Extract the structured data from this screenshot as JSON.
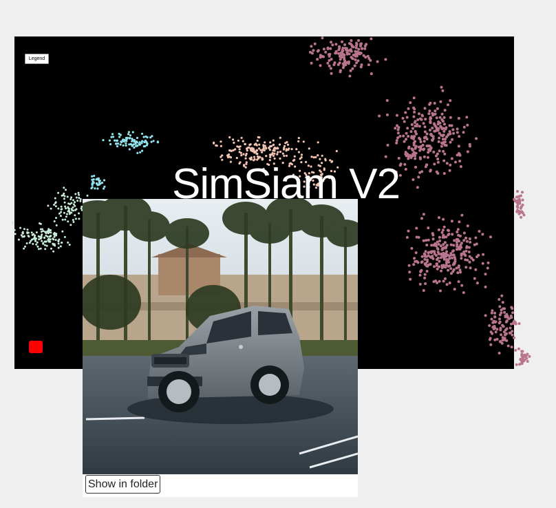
{
  "plot": {
    "title": "SimSiam V2",
    "legend_label": "Legend",
    "background": "#000000",
    "marker_color": "#ff0000",
    "cluster_colors": {
      "mint": "#c8ecd8",
      "cyan": "#8fe3ec",
      "peach": "#f2c4b2",
      "mauve": "#b9748e"
    }
  },
  "preview": {
    "image": "car-photo",
    "button_label": "Show in folder"
  }
}
